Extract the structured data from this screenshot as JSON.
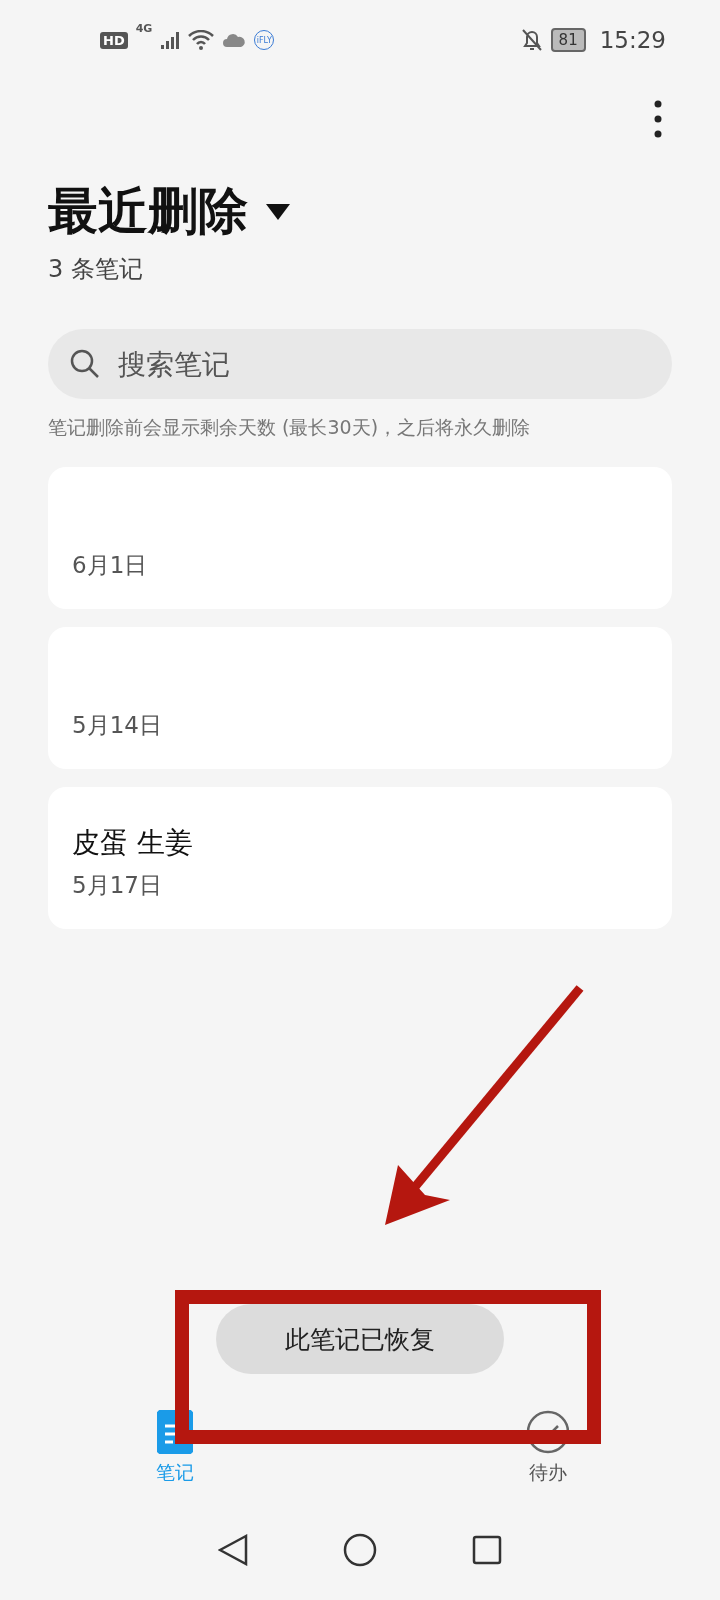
{
  "status_bar": {
    "hd": "HD",
    "network": "4G",
    "app_badge": "iFLY",
    "battery": "81",
    "time": "15:29"
  },
  "header": {
    "title": "最近删除",
    "subtitle": "3 条笔记"
  },
  "search": {
    "placeholder": "搜索笔记"
  },
  "notice": "笔记删除前会显示剩余天数 (最长30天)，之后将永久删除",
  "notes": [
    {
      "date": "6月1日"
    },
    {
      "date": "5月14日"
    },
    {
      "title": "皮蛋 生姜",
      "date": "5月17日"
    }
  ],
  "toast": "此笔记已恢复",
  "bottom_tabs": [
    {
      "label": "笔记",
      "kind": "notes",
      "selected": true
    },
    {
      "label": "待办",
      "kind": "todo",
      "selected": false
    }
  ]
}
